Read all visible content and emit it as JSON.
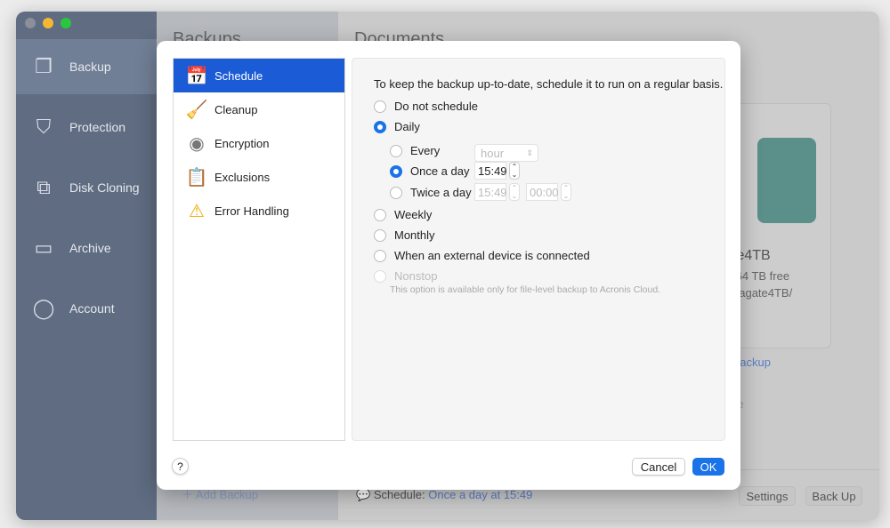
{
  "sidebar": {
    "items": [
      {
        "label": "Backup",
        "icon": "backup-icon"
      },
      {
        "label": "Protection",
        "icon": "shield-icon"
      },
      {
        "label": "Disk Cloning",
        "icon": "disk-clone-icon"
      },
      {
        "label": "Archive",
        "icon": "archive-icon"
      },
      {
        "label": "Account",
        "icon": "account-icon"
      }
    ]
  },
  "backups": {
    "title": "Backups",
    "add_label": "Add Backup"
  },
  "main": {
    "title": "Documents",
    "dest_name": "te4TB",
    "dest_free": ".64 TB free",
    "dest_path": "eagate4TB/",
    "link": "backup",
    "faded": "re",
    "schedule_label": "Schedule:",
    "schedule_value": "Once a day at 15:49",
    "settings_label": "Settings",
    "backup_label": "Back Up"
  },
  "dialog": {
    "tabs": [
      {
        "label": "Schedule",
        "icon": "calendar-icon"
      },
      {
        "label": "Cleanup",
        "icon": "broom-icon"
      },
      {
        "label": "Encryption",
        "icon": "lock-dial-icon"
      },
      {
        "label": "Exclusions",
        "icon": "checklist-icon"
      },
      {
        "label": "Error Handling",
        "icon": "warning-icon"
      }
    ],
    "intro": "To keep the backup up-to-date, schedule it to run on a regular basis.",
    "options": {
      "none": "Do not schedule",
      "daily": "Daily",
      "every": "Every",
      "every_unit": "hour",
      "once": "Once a day",
      "once_time": "15:49",
      "twice": "Twice a day",
      "twice_time1": "15:49",
      "twice_time2": "00:00",
      "weekly": "Weekly",
      "monthly": "Monthly",
      "external": "When an external device is connected",
      "nonstop": "Nonstop",
      "nonstop_note": "This option is available only for file-level backup to Acronis Cloud."
    },
    "help": "?",
    "cancel": "Cancel",
    "ok": "OK"
  },
  "colors": {
    "accent": "#1a73e8",
    "sidebar": "#5f6c81",
    "selected_tab": "#1b5bd6"
  }
}
